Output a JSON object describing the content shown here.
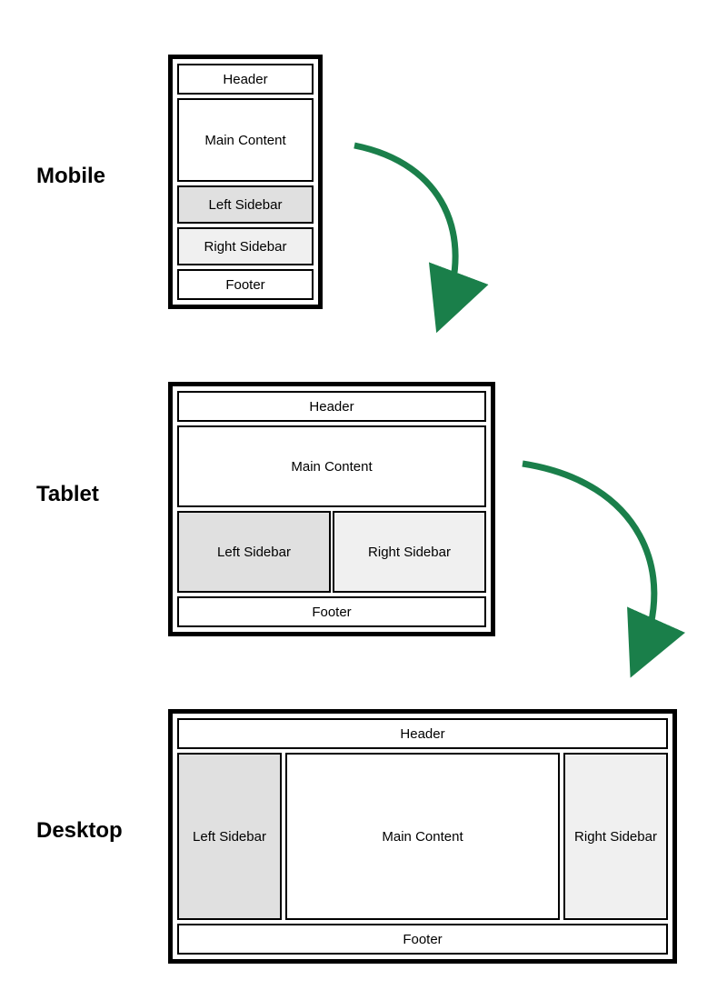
{
  "labels": {
    "mobile": "Mobile",
    "tablet": "Tablet",
    "desktop": "Desktop"
  },
  "regions": {
    "header": "Header",
    "main": "Main Content",
    "left": "Left Sidebar",
    "right": "Right Sidebar",
    "footer": "Footer"
  },
  "colors": {
    "arrow": "#1a7f4a",
    "shade_left": "#e0e0e0",
    "shade_right": "#f0f0f0"
  },
  "breakpoints": [
    "Mobile",
    "Tablet",
    "Desktop"
  ]
}
